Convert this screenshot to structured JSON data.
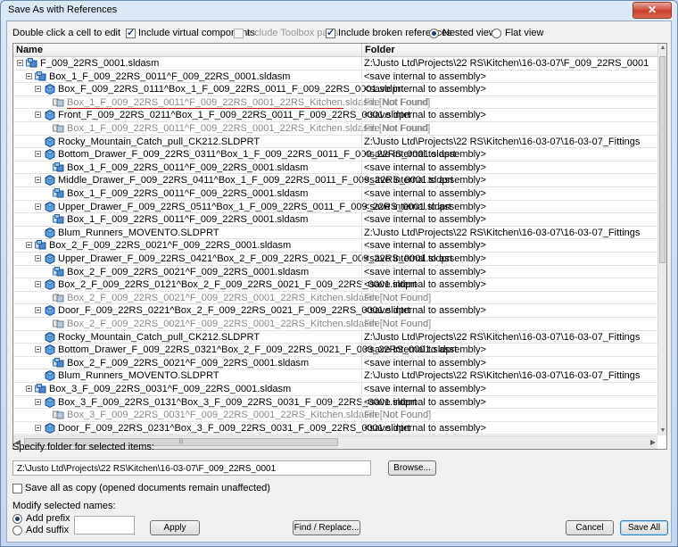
{
  "window": {
    "title": "Save As with References",
    "close_glyph": "✕"
  },
  "options": {
    "instruction": "Double click a cell to edit",
    "include_virtual": "Include virtual components",
    "include_toolbox": "Include Toolbox parts",
    "include_broken": "Include broken references",
    "nested_view": "Nested view",
    "flat_view": "Flat view"
  },
  "grid": {
    "col_name": "Name",
    "col_folder": "Folder",
    "rows": [
      {
        "level": 0,
        "expander": true,
        "icon": "assembly",
        "name": "F_009_22RS_0001.sldasm",
        "folder": "Z:\\Justo Ltd\\Projects\\22 RS\\Kitchen\\16-03-07\\F_009_22RS_0001",
        "grey": false
      },
      {
        "level": 1,
        "expander": true,
        "icon": "assembly",
        "name": "Box_1_F_009_22RS_0011^F_009_22RS_0001.sldasm",
        "folder": "<save internal to assembly>",
        "grey": false
      },
      {
        "level": 2,
        "expander": true,
        "icon": "part",
        "name": "Box_F_009_22RS_0111^Box_1_F_009_22RS_0011_F_009_22RS_0001.sldprt",
        "folder": "<save internal to assembly>",
        "grey": false
      },
      {
        "level": 3,
        "expander": false,
        "icon": "broken",
        "name": "Box_1_F_009_22RS_0011^F_009_22RS_0001_22RS_Kitchen.sldasm [Not Found]",
        "folder": "File Not Found",
        "grey": true,
        "underline": true
      },
      {
        "level": 2,
        "expander": true,
        "icon": "part",
        "name": "Front_F_009_22RS_0211^Box_1_F_009_22RS_0011_F_009_22RS_0001.sldprt",
        "folder": "<save internal to assembly>",
        "grey": false
      },
      {
        "level": 3,
        "expander": false,
        "icon": "broken",
        "name": "Box_1_F_009_22RS_0011^F_009_22RS_0001_22RS_Kitchen.sldasm [Not Found]",
        "folder": "File Not Found",
        "grey": true
      },
      {
        "level": 2,
        "expander": false,
        "icon": "part",
        "name": "Rocky_Mountain_Catch_pull_CK212.SLDPRT",
        "folder": "Z:\\Justo Ltd\\Projects\\22 RS\\Kitchen\\16-03-07\\16-03-07_Fittings",
        "grey": false
      },
      {
        "level": 2,
        "expander": true,
        "icon": "part",
        "name": "Bottom_Drawer_F_009_22RS_0311^Box_1_F_009_22RS_0011_F_009_22RS_0001.sldprt",
        "folder": "<save internal to assembly>",
        "grey": false
      },
      {
        "level": 3,
        "expander": false,
        "icon": "assembly",
        "name": "Box_1_F_009_22RS_0011^F_009_22RS_0001.sldasm",
        "folder": "<save internal to assembly>",
        "grey": false
      },
      {
        "level": 2,
        "expander": true,
        "icon": "part",
        "name": "Middle_Drawer_F_009_22RS_0411^Box_1_F_009_22RS_0011_F_009_22RS_0001.sldprt",
        "folder": "<save internal to assembly>",
        "grey": false
      },
      {
        "level": 3,
        "expander": false,
        "icon": "assembly",
        "name": "Box_1_F_009_22RS_0011^F_009_22RS_0001.sldasm",
        "folder": "<save internal to assembly>",
        "grey": false
      },
      {
        "level": 2,
        "expander": true,
        "icon": "part",
        "name": "Upper_Drawer_F_009_22RS_0511^Box_1_F_009_22RS_0011_F_009_22RS_0001.sldprt",
        "folder": "<save internal to assembly>",
        "grey": false
      },
      {
        "level": 3,
        "expander": false,
        "icon": "assembly",
        "name": "Box_1_F_009_22RS_0011^F_009_22RS_0001.sldasm",
        "folder": "<save internal to assembly>",
        "grey": false
      },
      {
        "level": 2,
        "expander": false,
        "icon": "part",
        "name": "Blum_Runners_MOVENTO.SLDPRT",
        "folder": "Z:\\Justo Ltd\\Projects\\22 RS\\Kitchen\\16-03-07\\16-03-07_Fittings",
        "grey": false
      },
      {
        "level": 1,
        "expander": true,
        "icon": "assembly",
        "name": "Box_2_F_009_22RS_0021^F_009_22RS_0001.sldasm",
        "folder": "<save internal to assembly>",
        "grey": false
      },
      {
        "level": 2,
        "expander": true,
        "icon": "part",
        "name": "Upper_Drawer_F_009_22RS_0421^Box_2_F_009_22RS_0021_F_009_22RS_0001.sldprt",
        "folder": "<save internal to assembly>",
        "grey": false
      },
      {
        "level": 3,
        "expander": false,
        "icon": "assembly",
        "name": "Box_2_F_009_22RS_0021^F_009_22RS_0001.sldasm",
        "folder": "<save internal to assembly>",
        "grey": false
      },
      {
        "level": 2,
        "expander": true,
        "icon": "part",
        "name": "Box_2_F_009_22RS_0121^Box_2_F_009_22RS_0021_F_009_22RS_0001.sldprt",
        "folder": "<save internal to assembly>",
        "grey": false
      },
      {
        "level": 3,
        "expander": false,
        "icon": "broken",
        "name": "Box_2_F_009_22RS_0021^F_009_22RS_0001_22RS_Kitchen.sldasm [Not Found]",
        "folder": "File Not Found",
        "grey": true
      },
      {
        "level": 2,
        "expander": true,
        "icon": "part",
        "name": "Door_F_009_22RS_0221^Box_2_F_009_22RS_0021_F_009_22RS_0001.sldprt",
        "folder": "<save internal to assembly>",
        "grey": false
      },
      {
        "level": 3,
        "expander": false,
        "icon": "broken",
        "name": "Box_2_F_009_22RS_0021^F_009_22RS_0001_22RS_Kitchen.sldasm [Not Found]",
        "folder": "File Not Found",
        "grey": true
      },
      {
        "level": 2,
        "expander": false,
        "icon": "part",
        "name": "Rocky_Mountain_Catch_pull_CK212.SLDPRT",
        "folder": "Z:\\Justo Ltd\\Projects\\22 RS\\Kitchen\\16-03-07\\16-03-07_Fittings",
        "grey": false
      },
      {
        "level": 2,
        "expander": true,
        "icon": "part",
        "name": "Bottom_Drawer_F_009_22RS_0321^Box_2_F_009_22RS_0021_F_009_22RS_0001.sldprt",
        "folder": "<save internal to assembly>",
        "grey": false
      },
      {
        "level": 3,
        "expander": false,
        "icon": "assembly",
        "name": "Box_2_F_009_22RS_0021^F_009_22RS_0001.sldasm",
        "folder": "<save internal to assembly>",
        "grey": false
      },
      {
        "level": 2,
        "expander": false,
        "icon": "part",
        "name": "Blum_Runners_MOVENTO.SLDPRT",
        "folder": "Z:\\Justo Ltd\\Projects\\22 RS\\Kitchen\\16-03-07\\16-03-07_Fittings",
        "grey": false
      },
      {
        "level": 1,
        "expander": true,
        "icon": "assembly",
        "name": "Box_3_F_009_22RS_0031^F_009_22RS_0001.sldasm",
        "folder": "<save internal to assembly>",
        "grey": false
      },
      {
        "level": 2,
        "expander": true,
        "icon": "part",
        "name": "Box_3_F_009_22RS_0131^Box_3_F_009_22RS_0031_F_009_22RS_0001.sldprt",
        "folder": "<save internal to assembly>",
        "grey": false
      },
      {
        "level": 3,
        "expander": false,
        "icon": "broken",
        "name": "Box_3_F_009_22RS_0031^F_009_22RS_0001_22RS_Kitchen.sldasm [Not Found]",
        "folder": "File Not Found",
        "grey": true
      },
      {
        "level": 2,
        "expander": true,
        "icon": "part",
        "name": "Door_F_009_22RS_0231^Box_3_F_009_22RS_0031_F_009_22RS_0001.sldprt",
        "folder": "<save internal to assembly>",
        "grey": false
      }
    ]
  },
  "bottom": {
    "folder_label": "Specify folder for selected items:",
    "folder_value": "Z:\\Justo Ltd\\Projects\\22 RS\\Kitchen\\16-03-07\\F_009_22RS_0001",
    "browse": "Browse...",
    "save_copy": "Save all as copy (opened documents remain unaffected)",
    "modify_label": "Modify selected names:",
    "add_prefix": "Add prefix",
    "add_suffix": "Add suffix",
    "prefix_value": "",
    "apply": "Apply",
    "find_replace": "Find / Replace...",
    "cancel": "Cancel",
    "save_all": "Save All"
  },
  "scroll": {
    "up": "▲",
    "down": "▼",
    "left": "◀",
    "right": "▶",
    "grip": "|||"
  }
}
